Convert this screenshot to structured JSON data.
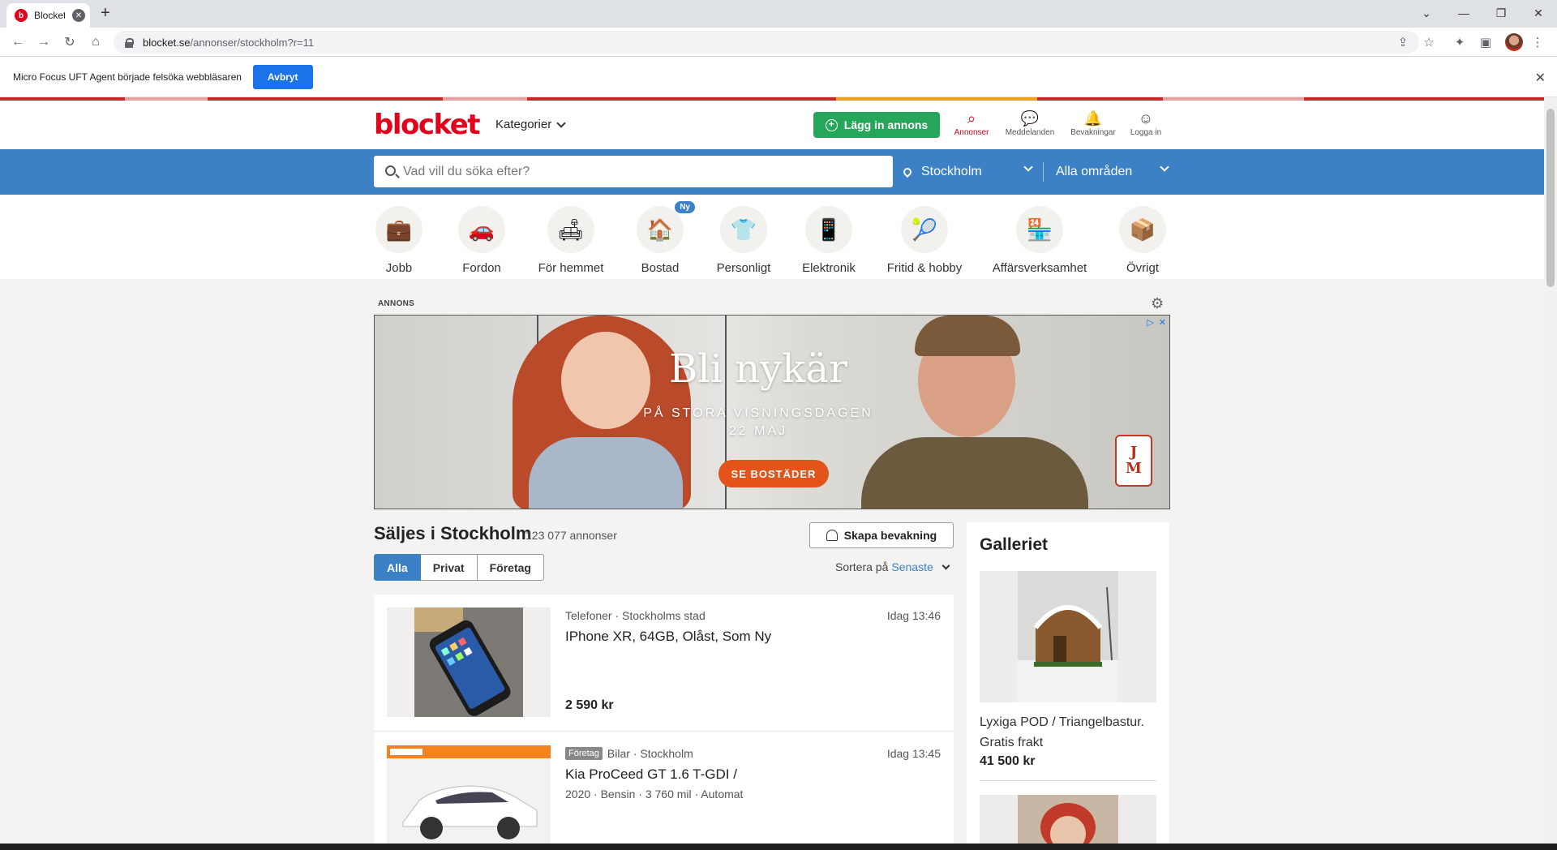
{
  "browser": {
    "tab_title": "Blocket",
    "tab_favicon": "b",
    "new_tab_label": "+",
    "url_host": "blocket.se",
    "url_path": "/annonser/stockholm?r=11"
  },
  "infobar": {
    "message": "Micro Focus UFT Agent började felsöka webbläsaren",
    "button_label": "Avbryt"
  },
  "header": {
    "logo_text": "blocket",
    "categories_label": "Kategorier",
    "post_ad_label": "Lägg in annons",
    "nav": [
      {
        "label": "Annonser",
        "icon": "search-icon"
      },
      {
        "label": "Meddelanden",
        "icon": "chat-icon"
      },
      {
        "label": "Bevakningar",
        "icon": "bell-icon"
      },
      {
        "label": "Logga in",
        "icon": "user-icon"
      }
    ]
  },
  "search": {
    "placeholder": "Vad vill du söka efter?",
    "location": "Stockholm",
    "area": "Alla områden"
  },
  "categories": [
    {
      "label": "Jobb",
      "icon": "briefcase-icon"
    },
    {
      "label": "Fordon",
      "icon": "car-icon"
    },
    {
      "label": "För hemmet",
      "icon": "armchair-icon"
    },
    {
      "label": "Bostad",
      "icon": "house-icon",
      "badge": "Ny"
    },
    {
      "label": "Personligt",
      "icon": "shirt-icon"
    },
    {
      "label": "Elektronik",
      "icon": "phone-icon"
    },
    {
      "label": "Fritid & hobby",
      "icon": "racket-icon"
    },
    {
      "label": "Affärsverksamhet",
      "icon": "shop-icon"
    },
    {
      "label": "Övrigt",
      "icon": "box-icon"
    }
  ],
  "ad": {
    "label": "ANNONS",
    "headline": "Bli nykär",
    "sub_line1": "PÅ STORA VISNINGSDAGEN",
    "sub_line2": "22 MAJ",
    "cta": "SE BOSTÄDER",
    "brand_line1": "J",
    "brand_line2": "M"
  },
  "listings_section": {
    "title": "Säljes i Stockholm",
    "count": "123 077 annonser",
    "alert_button": "Skapa bevakning",
    "filter_tabs": [
      {
        "label": "Alla",
        "active": true
      },
      {
        "label": "Privat",
        "active": false
      },
      {
        "label": "Företag",
        "active": false
      }
    ],
    "sort_label": "Sortera på",
    "sort_value": "Senaste"
  },
  "listings": [
    {
      "tag": "",
      "category": "Telefoner · Stockholms stad",
      "time": "Idag 13:46",
      "title": "IPhone XR, 64GB, Olåst, Som Ny",
      "details": "",
      "price": "2 590 kr"
    },
    {
      "tag": "Företag",
      "category": "Bilar · Stockholm",
      "time": "Idag 13:45",
      "title": "Kia ProCeed GT 1.6 T-GDI /",
      "details": "2020 · Bensin · 3 760 mil · Automat",
      "price": ""
    }
  ],
  "gallery": {
    "title": "Galleriet",
    "item_name": "Lyxiga POD / Triangelbastur. Gratis frakt",
    "item_price": "41 500 kr"
  },
  "colors": {
    "brand_red": "#e2001a",
    "search_blue": "#3c80c5",
    "cta_green": "#26a65b"
  }
}
